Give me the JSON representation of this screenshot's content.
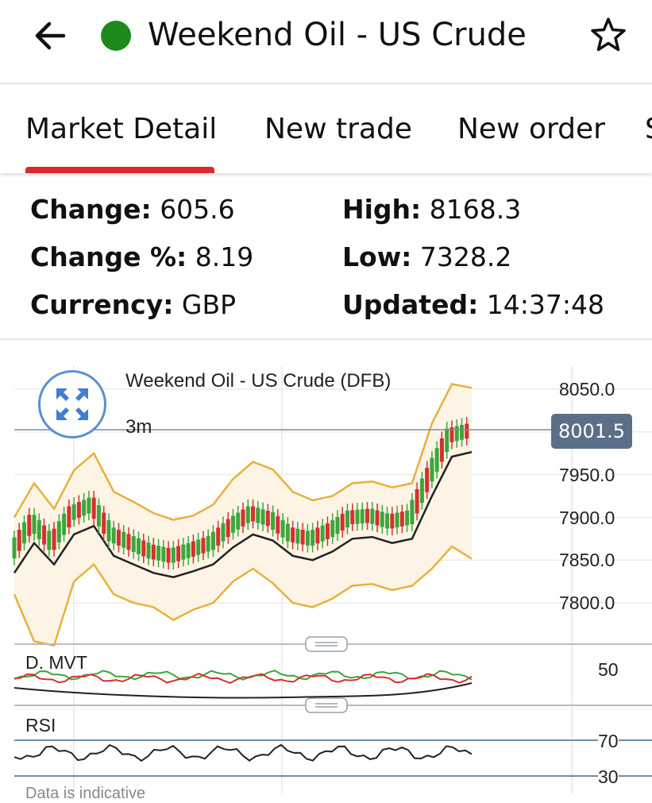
{
  "header": {
    "title": "Weekend Oil - US Crude",
    "status_color": "#1e8a1e",
    "back_icon": "arrow-left-icon",
    "favorite_icon": "star-outline-icon"
  },
  "tabs": [
    {
      "label": "Market Detail",
      "active": true
    },
    {
      "label": "New trade",
      "active": false
    },
    {
      "label": "New order",
      "active": false
    },
    {
      "label": "S",
      "active": false
    }
  ],
  "stats": {
    "change": {
      "label": "Change:",
      "value": "605.6"
    },
    "change_pct": {
      "label": "Change %:",
      "value": "8.19"
    },
    "currency": {
      "label": "Currency:",
      "value": "GBP"
    },
    "high": {
      "label": "High:",
      "value": "8168.3"
    },
    "low": {
      "label": "Low:",
      "value": "7328.2"
    },
    "updated": {
      "label": "Updated:",
      "value": "14:37:48"
    }
  },
  "chart": {
    "title": "Weekend Oil - US Crude (DFB)",
    "interval": "3m",
    "current_price": "8001.5",
    "expand_icon": "expand-icon",
    "indicators": {
      "dmvt": {
        "label": "D. MVT",
        "level": "50"
      },
      "rsi": {
        "label": "RSI",
        "upper": "70",
        "lower": "30"
      }
    },
    "footnote": "Data is indicative",
    "colors": {
      "up": "#3aa83a",
      "down": "#d63030",
      "band": "#e8b13a",
      "ma": "#222222",
      "band_fill": "#fdf4e6"
    }
  },
  "chart_data": {
    "type": "line",
    "series": [
      {
        "values": [
          7860,
          7895,
          7870,
          7905,
          7915,
          7880,
          7870,
          7860,
          7855,
          7862,
          7870,
          7890,
          7905,
          7898,
          7880,
          7875,
          7885,
          7900,
          7902,
          7895,
          7900,
          7950,
          7996,
          8001.5
        ]
      }
    ],
    "ylim": [
      7770,
      8070
    ],
    "yticks": [
      8050.0,
      8000.0,
      7950.0,
      7900.0,
      7850.0,
      7800.0
    ],
    "ytick_labels": [
      "8050.0",
      "7950.0",
      "7900.0",
      "7850.0",
      "7800.0"
    ],
    "grid": true
  }
}
